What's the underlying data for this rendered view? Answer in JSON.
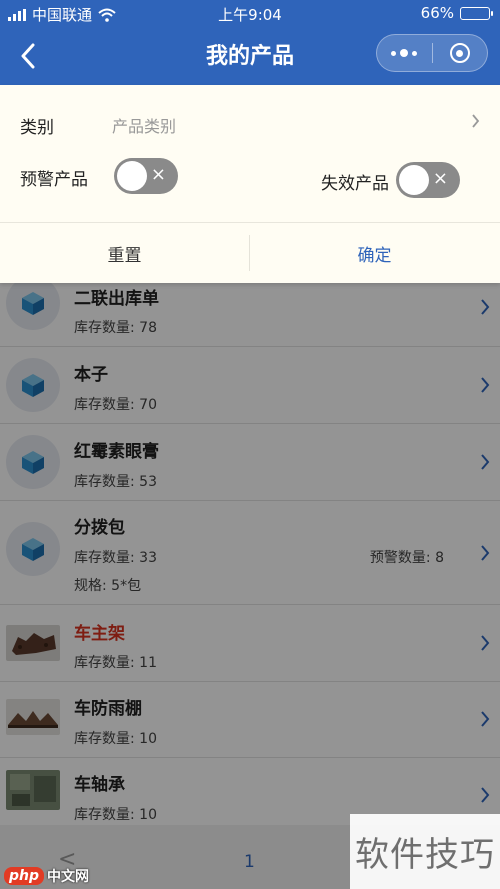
{
  "status": {
    "carrier": "中国联通",
    "time": "上午9:04",
    "battery": "66%",
    "battery_level": 0.66
  },
  "nav": {
    "title": "我的产品",
    "back_icon": "chevron-left-icon",
    "more_icon": "more-dots-icon",
    "close_icon": "target-icon"
  },
  "filter": {
    "category_label": "类别",
    "category_placeholder": "产品类别",
    "warning_label": "预警产品",
    "invalid_label": "失效产品",
    "warning_on": false,
    "invalid_on": false,
    "toggle_off_mark": "×",
    "reset_label": "重置",
    "confirm_label": "确定"
  },
  "products": [
    {
      "name": "二联出库单",
      "stock": "库存数量: 78",
      "image": "cube-icon"
    },
    {
      "name": "本子",
      "stock": "库存数量: 70",
      "image": "cube-icon"
    },
    {
      "name": "红霉素眼膏",
      "stock": "库存数量: 53",
      "image": "cube-icon"
    },
    {
      "name": "分拨包",
      "stock": "库存数量: 33",
      "warning": "预警数量: 8",
      "spec": "规格: 5*包",
      "image": "cube-icon"
    },
    {
      "name": "车主架",
      "stock": "库存数量: 11",
      "image": "photo"
    },
    {
      "name": "车防雨棚",
      "stock": "库存数量: 10",
      "image": "photo"
    },
    {
      "name": "车轴承",
      "stock": "库存数量: 10",
      "image": "photo"
    }
  ],
  "pager": {
    "prev": "<",
    "page": "1"
  },
  "watermark": {
    "text": "软件技巧",
    "badge_logo": "php",
    "badge_text": "中文网"
  },
  "colors": {
    "primary": "#2f64ba",
    "alert": "#d9331f",
    "panel": "#fffdf3"
  }
}
